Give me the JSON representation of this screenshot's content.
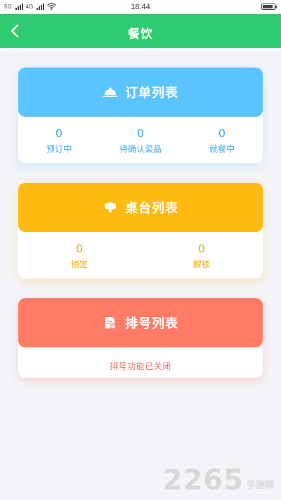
{
  "status_bar": {
    "carrier1": "5G",
    "carrier2": "4G",
    "time": "18:44"
  },
  "header": {
    "title": "餐饮",
    "back_icon": "chevron-left-icon"
  },
  "colors": {
    "header": "#2ecc71",
    "order": "#5bc4ff",
    "table": "#ffbb12",
    "queue": "#ff7b66"
  },
  "order_card": {
    "title": "订单列表",
    "icon": "cloche-icon",
    "stats": [
      {
        "value": "0",
        "label": "预订中"
      },
      {
        "value": "0",
        "label": "待确认菜品"
      },
      {
        "value": "0",
        "label": "就餐中"
      }
    ]
  },
  "table_card": {
    "title": "桌台列表",
    "icon": "table-icon",
    "stats": [
      {
        "value": "0",
        "label": "锁定"
      },
      {
        "value": "0",
        "label": "解锁"
      }
    ]
  },
  "queue_card": {
    "title": "排号列表",
    "icon": "ticket-icon",
    "message": "排号功能已关闭"
  },
  "watermark": {
    "number": "2265",
    "text": "手游网"
  }
}
